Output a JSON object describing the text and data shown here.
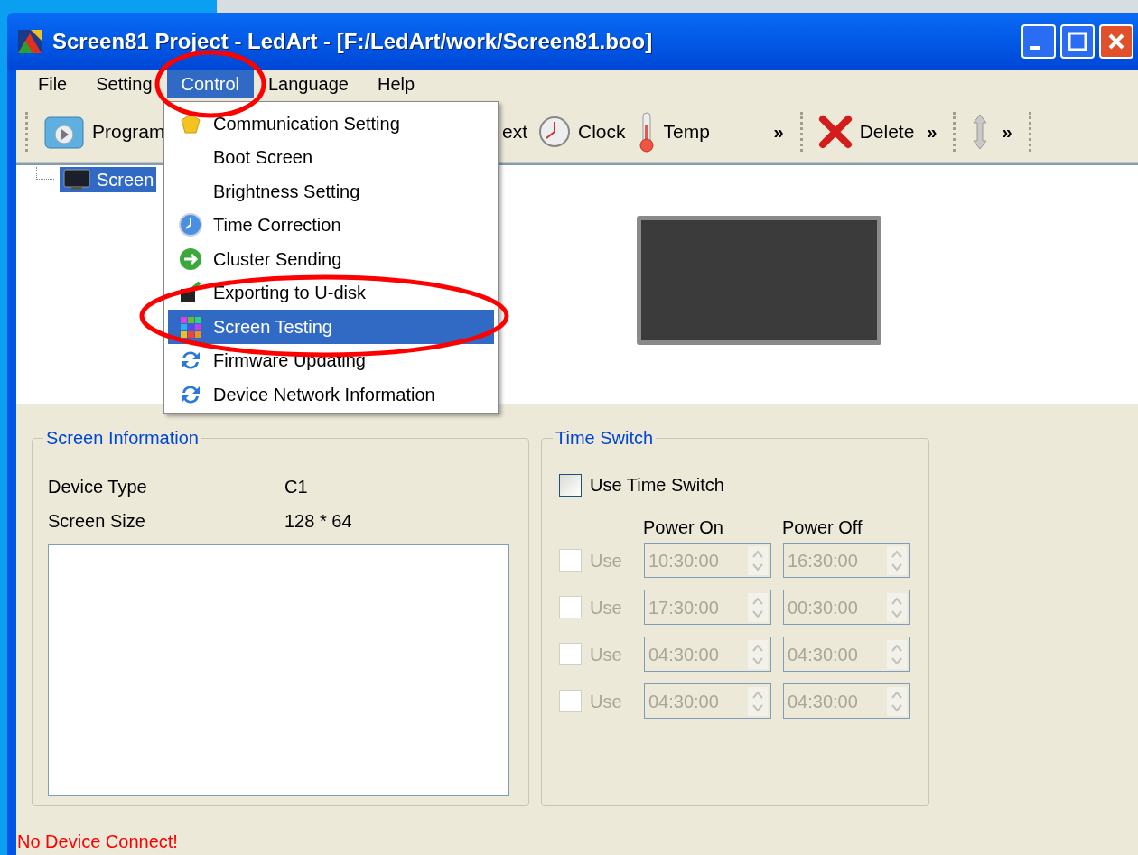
{
  "window": {
    "title": "Screen81 Project - LedArt - [F:/LedArt/work/Screen81.boo]"
  },
  "menu_bar": [
    {
      "label": "File",
      "selected": false
    },
    {
      "label": "Setting",
      "selected": false
    },
    {
      "label": "Control",
      "selected": true
    },
    {
      "label": "Language",
      "selected": false
    },
    {
      "label": "Help",
      "selected": false
    }
  ],
  "toolbar": [
    {
      "kind": "program",
      "label": "Program"
    },
    {
      "kind": "text",
      "label": "ext"
    },
    {
      "kind": "clock",
      "label": "Clock"
    },
    {
      "kind": "temp",
      "label": "Temp"
    },
    {
      "kind": "more",
      "label": "»"
    },
    {
      "kind": "delete",
      "label": "Delete"
    },
    {
      "kind": "more",
      "label": "»"
    },
    {
      "kind": "move"
    },
    {
      "kind": "more",
      "label": "»"
    }
  ],
  "tree": {
    "items": [
      {
        "label": "Screen",
        "selected": true
      }
    ]
  },
  "control_menu": [
    {
      "label": "Communication Setting",
      "selected": false
    },
    {
      "label": "Boot Screen",
      "selected": false
    },
    {
      "label": "Brightness Setting",
      "selected": false
    },
    {
      "label": "Time Correction",
      "selected": false
    },
    {
      "label": "Cluster Sending",
      "selected": false
    },
    {
      "label": "Exporting to U-disk",
      "selected": false
    },
    {
      "label": "Screen Testing",
      "selected": true
    },
    {
      "label": "Firmware Updating",
      "selected": false
    },
    {
      "label": "Device Network Information",
      "selected": false
    }
  ],
  "screen_information": {
    "title": "Screen Information",
    "fields": [
      {
        "label": "Device Type",
        "value": "C1"
      },
      {
        "label": "Screen Size",
        "value": "128 * 64"
      }
    ]
  },
  "time_switch": {
    "title": "Time Switch",
    "use_label": "Use Time Switch",
    "checked": false,
    "power_on_header": "Power On",
    "power_off_header": "Power Off",
    "rows": [
      {
        "label": "Use",
        "checked": false,
        "disabled": true,
        "power_on": "10:30:00",
        "power_off": "16:30:00"
      },
      {
        "label": "Use",
        "checked": false,
        "disabled": true,
        "power_on": "17:30:00",
        "power_off": "00:30:00"
      },
      {
        "label": "Use",
        "checked": false,
        "disabled": true,
        "power_on": "04:30:00",
        "power_off": "04:30:00"
      },
      {
        "label": "Use",
        "checked": false,
        "disabled": true,
        "power_on": "04:30:00",
        "power_off": "04:30:00"
      }
    ]
  },
  "status_bar": {
    "text": "No Device Connect!"
  }
}
